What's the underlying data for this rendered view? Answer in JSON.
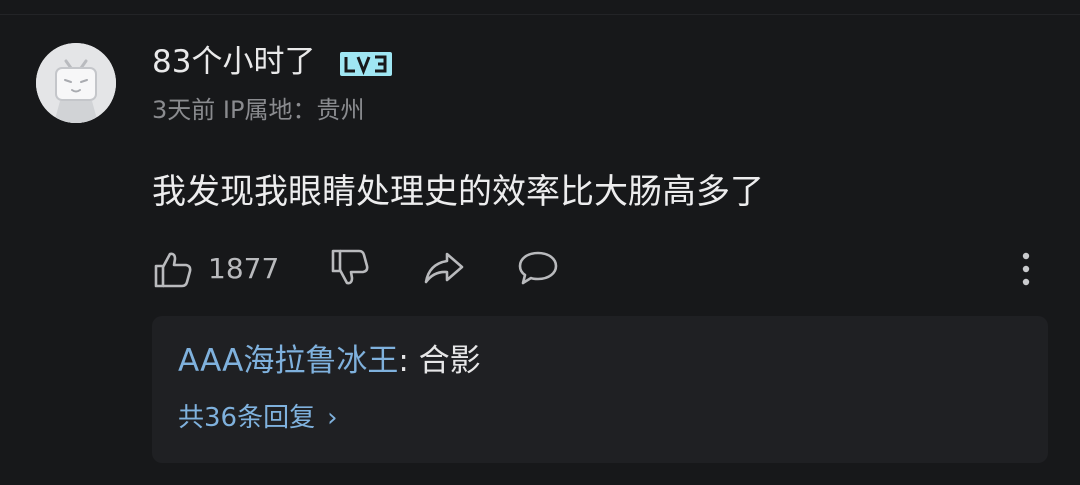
{
  "comment": {
    "username": "83个小时了",
    "level_badge": "LV3",
    "meta": "3天前 IP属地：贵州",
    "content": "我发现我眼睛处理史的效率比大肠高多了",
    "like_count": "1877"
  },
  "reply_preview": {
    "author": "AAA海拉鲁冰王",
    "separator": ":",
    "text": "合影",
    "count_label": "共36条回复"
  },
  "icons": [
    "thumbs-up-icon",
    "thumbs-down-icon",
    "share-icon",
    "comment-icon",
    "more-icon",
    "chevron-right-icon"
  ],
  "colors": {
    "background": "#17181a",
    "reply_box": "#1f2023",
    "link_blue": "#7fb1dd",
    "badge_cyan": "#9fe6f3"
  }
}
